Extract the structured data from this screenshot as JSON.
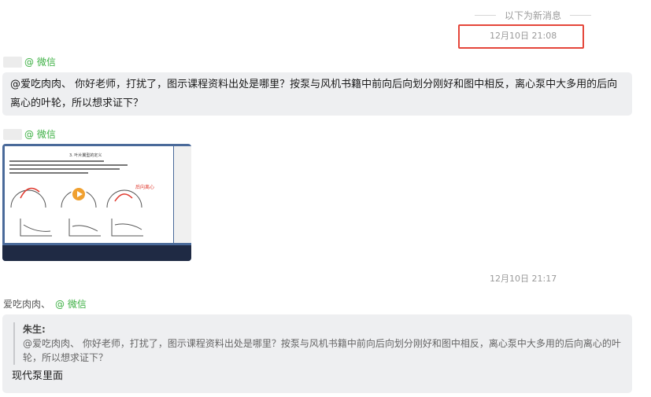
{
  "divider": {
    "text": "以下为新消息"
  },
  "timestamps": {
    "first": "12月10日 21:08",
    "second": "12月10日 21:17"
  },
  "messages": [
    {
      "tag": "@ 微信",
      "text": "@爱吃肉肉、 你好老师，打扰了，图示课程资料出处是哪里？按泵与风机书籍中前向后向划分刚好和图中相反，离心泵中大多用的后向离心的叶轮，所以想求证下？"
    },
    {
      "tag": "@ 微信",
      "image": {
        "doc_title": "3. 叶片翼型的定义",
        "label": "后向离心"
      }
    },
    {
      "name": "爱吃肉肉、",
      "tag": "@ 微信",
      "quote": {
        "author": "朱生:",
        "text": "@爱吃肉肉、 你好老师，打扰了，图示课程资料出处是哪里？按泵与风机书籍中前向后向划分刚好和图中相反，离心泵中大多用的后向离心的叶轮，所以想求证下？"
      },
      "reply": "现代泵里面"
    }
  ],
  "colors": {
    "highlight": "#e5463a",
    "wechat_tag": "#3cb043",
    "bubble": "#eeeff1"
  }
}
